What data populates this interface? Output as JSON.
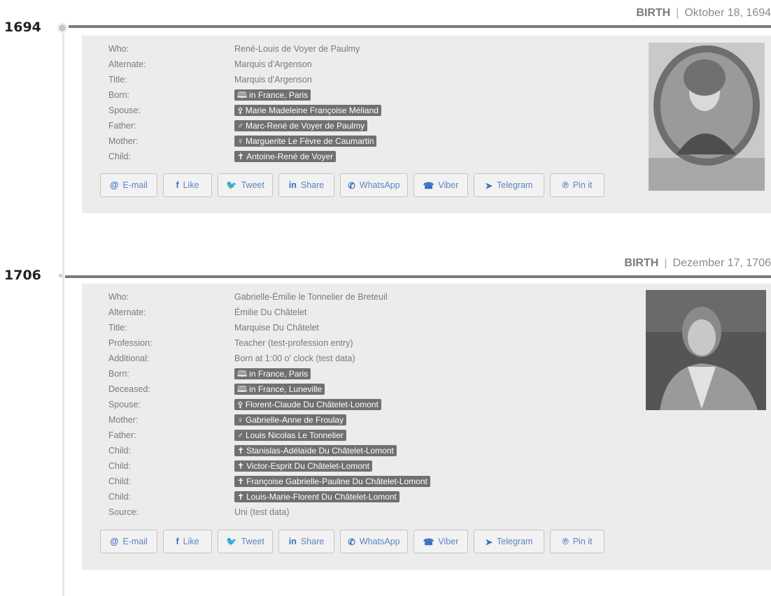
{
  "events": [
    {
      "year": "1694",
      "type": "BIRTH",
      "date": "Oktober 18, 1694",
      "rows": [
        {
          "label": "Who:",
          "value": "René-Louis de Voyer de Paulmy",
          "tag": false
        },
        {
          "label": "Alternate:",
          "value": "Marquis d'Argenson",
          "tag": false
        },
        {
          "label": "Title:",
          "value": "Marquis d'Argenson",
          "tag": false
        },
        {
          "label": "Born:",
          "value": "in France, Paris",
          "tag": true,
          "icon": "🕮"
        },
        {
          "label": "Spouse:",
          "value": "Marie Madeleine Françoise Méliand",
          "tag": true,
          "icon": "⚴"
        },
        {
          "label": "Father:",
          "value": "Marc-René de Voyer de Paulmy",
          "tag": true,
          "icon": "♂"
        },
        {
          "label": "Mother:",
          "value": "Marguerite Le Fèvre de Caumartin",
          "tag": true,
          "icon": "♀"
        },
        {
          "label": "Child:",
          "value": "Antoine-René de Voyer",
          "tag": true,
          "icon": "✝"
        }
      ]
    },
    {
      "year": "1706",
      "type": "BIRTH",
      "date": "Dezember 17, 1706",
      "rows": [
        {
          "label": "Who:",
          "value": "Gabrielle-Émilie le Tonnelier de Breteuil",
          "tag": false
        },
        {
          "label": "Alternate:",
          "value": "Émilie Du Châtelet",
          "tag": false
        },
        {
          "label": "Title:",
          "value": "Marquise Du Châtelet",
          "tag": false
        },
        {
          "label": "Profession:",
          "value": "Teacher (test-profession entry)",
          "tag": false
        },
        {
          "label": "Additional:",
          "value": "Born at 1:00 o' clock (test data)",
          "tag": false
        },
        {
          "label": "Born:",
          "value": "in France, Paris",
          "tag": true,
          "icon": "🕮"
        },
        {
          "label": "Deceased:",
          "value": "in France, Luneville",
          "tag": true,
          "icon": "🕮"
        },
        {
          "label": "Spouse:",
          "value": "Florent-Claude Du Châtelet-Lomont",
          "tag": true,
          "icon": "⚴"
        },
        {
          "label": "Mother:",
          "value": "Gabrielle-Anne de Froulay",
          "tag": true,
          "icon": "♀"
        },
        {
          "label": "Father:",
          "value": "Louis Nicolas Le Tonnelier",
          "tag": true,
          "icon": "♂"
        },
        {
          "label": "Child:",
          "value": "Stanislas-Adélaïde Du Châtelet-Lomont",
          "tag": true,
          "icon": "✝"
        },
        {
          "label": "Child:",
          "value": "Victor-Esprit Du Châtelet-Lomont",
          "tag": true,
          "icon": "✝"
        },
        {
          "label": "Child:",
          "value": "Françoise Gabrielle-Pauline Du Châtelet-Lomont",
          "tag": true,
          "icon": "✝"
        },
        {
          "label": "Child:",
          "value": "Louis-Marie-Florent Du Châtelet-Lomont",
          "tag": true,
          "icon": "✝"
        },
        {
          "label": "Source:",
          "value": "Uni (test data)",
          "tag": false
        }
      ]
    }
  ],
  "share_buttons": [
    {
      "label": "E-mail",
      "icon": "@",
      "icon_name": "email-icon"
    },
    {
      "label": "Like",
      "icon": "f",
      "icon_name": "facebook-icon"
    },
    {
      "label": "Tweet",
      "icon": "🐦",
      "icon_name": "twitter-icon"
    },
    {
      "label": "Share",
      "icon": "in",
      "icon_name": "linkedin-icon"
    },
    {
      "label": "WhatsApp",
      "icon": "✆",
      "icon_name": "whatsapp-icon"
    },
    {
      "label": "Viber",
      "icon": "☎",
      "icon_name": "viber-icon"
    },
    {
      "label": "Telegram",
      "icon": "➤",
      "icon_name": "telegram-icon"
    },
    {
      "label": "Pin it",
      "icon": "℗",
      "icon_name": "pinterest-icon"
    }
  ],
  "separator": "|"
}
